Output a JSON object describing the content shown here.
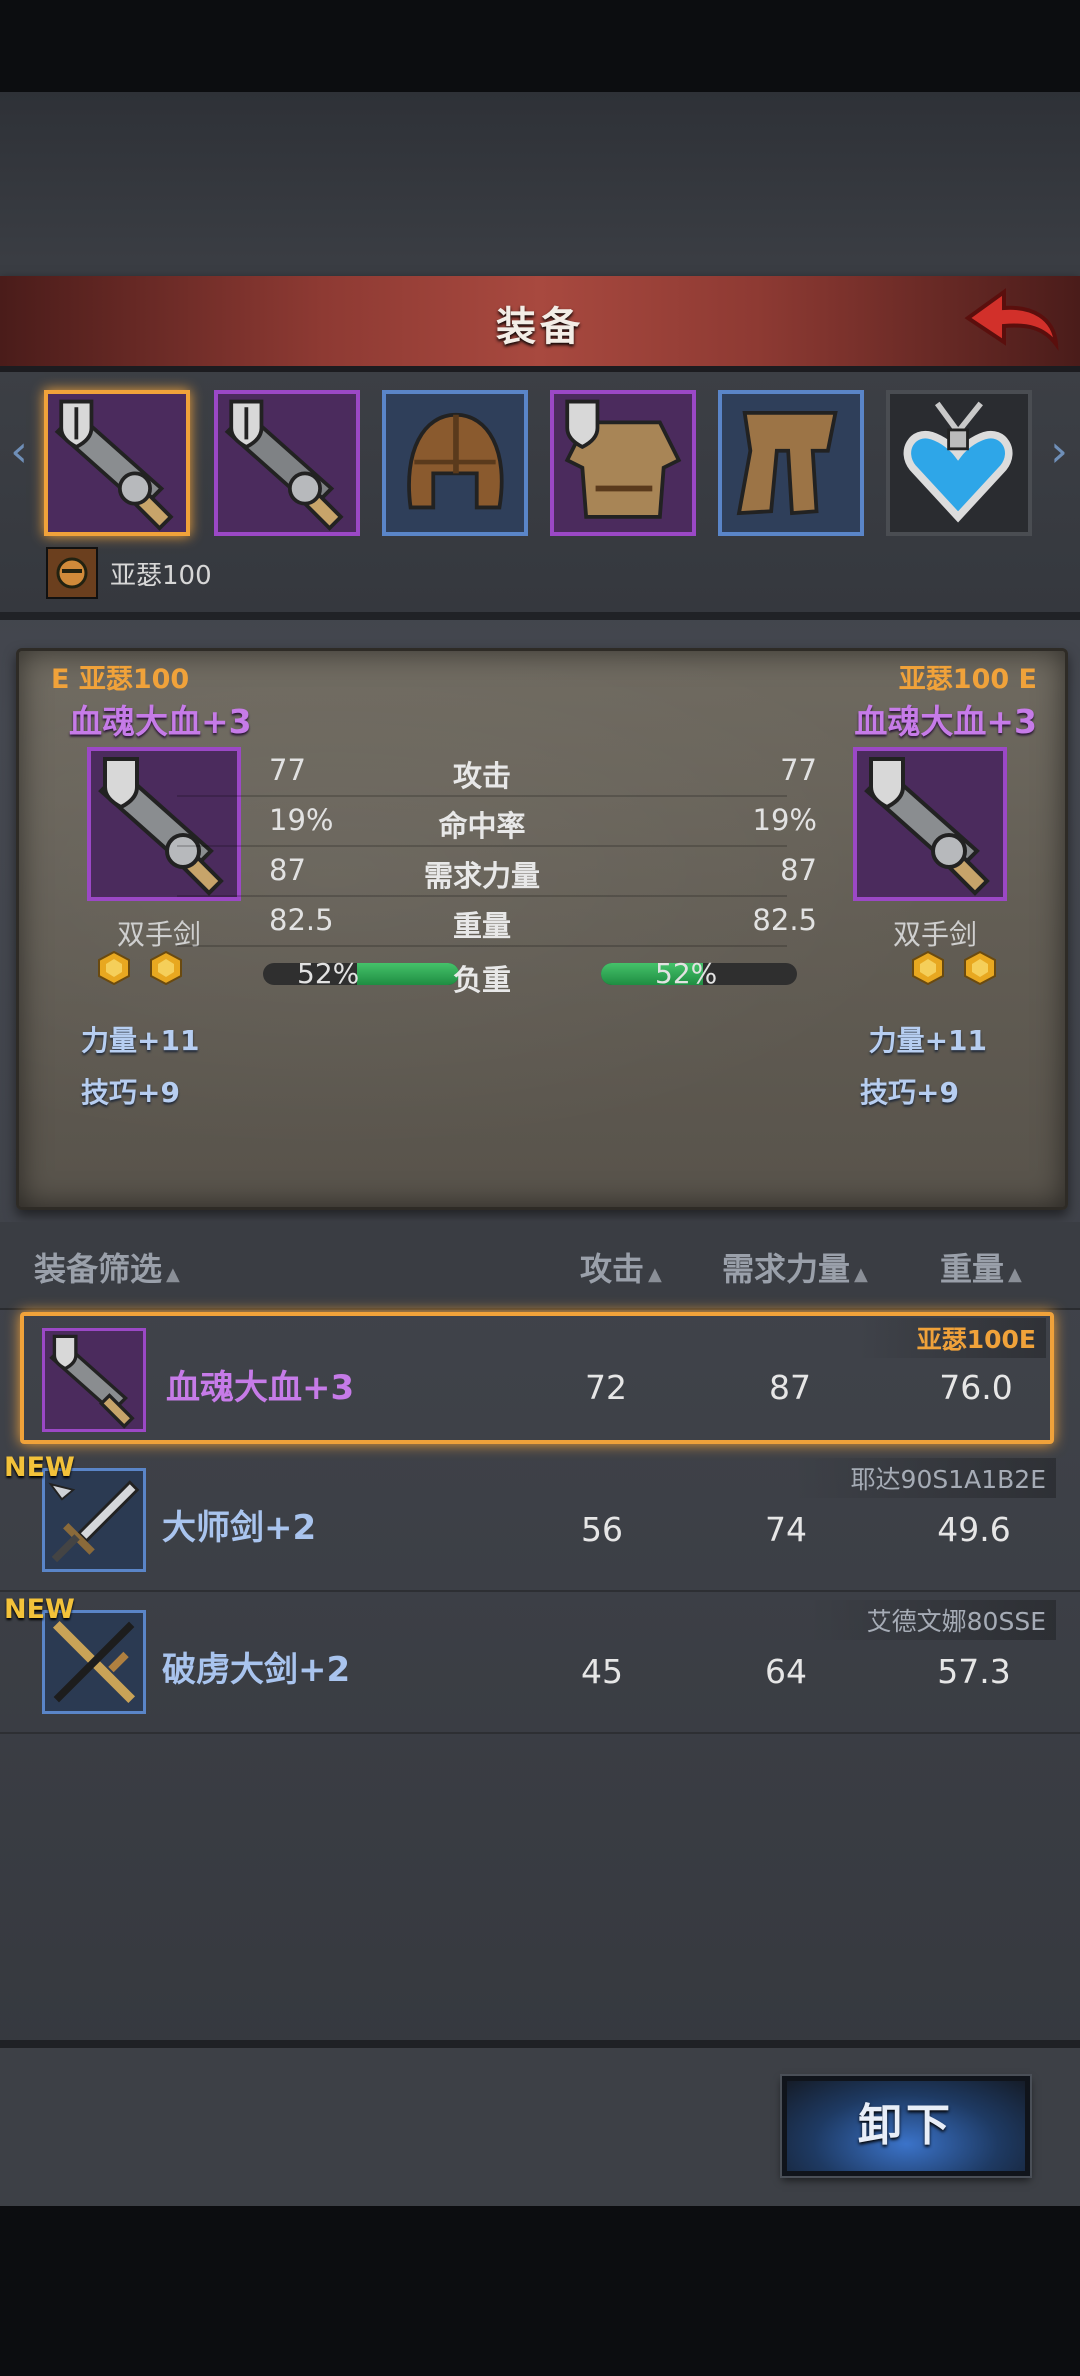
{
  "header": {
    "title": "装备"
  },
  "slots": {
    "owner_name": "亚瑟100",
    "items": [
      "greatsword-icon",
      "greatsword-icon",
      "helmet-icon",
      "armor-icon",
      "boots-icon",
      "amulet-icon"
    ]
  },
  "compare": {
    "left": {
      "owner": "E 亚瑟100",
      "name": "血魂大血+3",
      "type": "双手剑",
      "bonus1": "力量+11",
      "bonus2": "技巧+9"
    },
    "right": {
      "owner": "亚瑟100 E",
      "name": "血魂大血+3",
      "type": "双手剑",
      "bonus1": "力量+11",
      "bonus2": "技巧+9"
    },
    "stats": [
      {
        "label": "攻击",
        "left": "77",
        "right": "77"
      },
      {
        "label": "命中率",
        "left": "19%",
        "right": "19%"
      },
      {
        "label": "需求力量",
        "left": "87",
        "right": "87"
      },
      {
        "label": "重量",
        "left": "82.5",
        "right": "82.5"
      }
    ],
    "load": {
      "label": "负重",
      "left": "52%",
      "right": "52%",
      "left_fraction": 0.52,
      "right_fraction": 0.52
    }
  },
  "list": {
    "headers": {
      "filter": "装备筛选",
      "attack": "攻击",
      "strength": "需求力量",
      "weight": "重量"
    },
    "rows": [
      {
        "name": "血魂大血+3",
        "attack": "72",
        "strength": "87",
        "weight": "76.0",
        "owner": "亚瑟100E",
        "new": ""
      },
      {
        "name": "大师剑+2",
        "attack": "56",
        "strength": "74",
        "weight": "49.6",
        "owner": "耶达90S1A1B2E",
        "new": "NEW"
      },
      {
        "name": "破虏大剑+2",
        "attack": "45",
        "strength": "64",
        "weight": "57.3",
        "owner": "艾德文娜80SSE",
        "new": "NEW"
      }
    ]
  },
  "footer": {
    "unequip_label": "卸下"
  },
  "colors": {
    "accent_orange": "#f0a23a",
    "epic_purple": "#9b48c6",
    "rare_blue": "#5a85c8"
  }
}
